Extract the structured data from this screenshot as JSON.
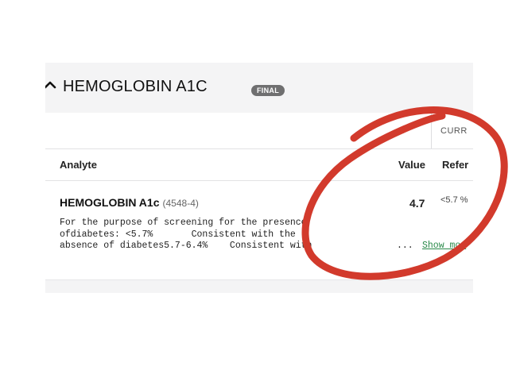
{
  "section": {
    "title": "HEMOGLOBIN A1C",
    "status_badge": "FINAL"
  },
  "subheader": {
    "current_label": "CURR"
  },
  "table": {
    "columns": {
      "analyte": "Analyte",
      "value": "Value",
      "reference": "Refer"
    },
    "rows": [
      {
        "analyte": "HEMOGLOBIN A1c",
        "code": "(4548-4)",
        "value": "4.7",
        "reference": "<5.7 %",
        "comment_lines": [
          "For the purpose of screening for the presence",
          "ofdiabetes: <5.7%       Consistent with the",
          "absence of diabetes5.7-6.4%    Consistent with"
        ],
        "ellipsis": "...",
        "show_more": "Show mor"
      }
    ]
  },
  "annotation": {
    "color": "#d23a2c",
    "shape": "hand-drawn-circle"
  }
}
